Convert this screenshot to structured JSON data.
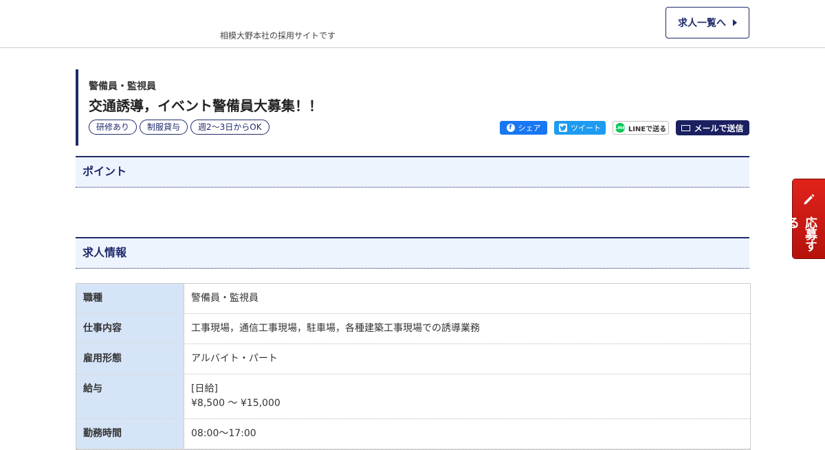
{
  "header": {
    "tagline": "相模大野本社の採用サイトです",
    "joblist_label": "求人一覧へ"
  },
  "job": {
    "category": "警備員・監視員",
    "title": "交通誘導，イベント警備員大募集！！",
    "tags": [
      "研修あり",
      "制服貸与",
      "週2〜3日からOK"
    ]
  },
  "share": {
    "facebook": "シェア",
    "twitter": "ツイート",
    "line": "LINEで送る",
    "mail": "メールで送信"
  },
  "sections": {
    "point": "ポイント",
    "info": "求人情報"
  },
  "table": [
    {
      "label": "職種",
      "value": "警備員・監視員"
    },
    {
      "label": "仕事内容",
      "value": "工事現場，通信工事現場，駐車場，各種建築工事現場での誘導業務"
    },
    {
      "label": "雇用形態",
      "value": "アルバイト・パート"
    },
    {
      "label": "給与",
      "value": "[日給]",
      "value2": "¥8,500 ～ ¥15,000"
    },
    {
      "label": "勤務時間",
      "value": "08:00～17:00"
    }
  ],
  "apply_tab": {
    "label": "応募する"
  },
  "colors": {
    "accent": "#1f2a6b",
    "section_bg": "#eef4fd",
    "table_header_bg": "#d5e4f7",
    "apply_red": "#d31d15"
  }
}
